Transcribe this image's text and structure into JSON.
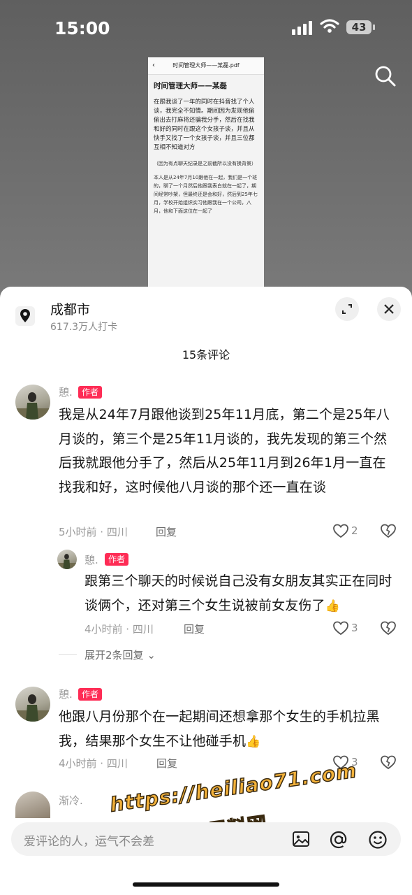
{
  "status": {
    "time": "15:00",
    "battery": "43"
  },
  "document": {
    "header": "时间管理大师——某磊.pdf",
    "title": "时间管理大师——某磊",
    "para1": "在跟我谈了一年的同时在抖音找了个人谈，我完全不知情。期间因为发现他偷偷出去打麻将还骗我分手，然后在找我和好的同时在跟这个女孩子谈，并且从快手又找了一个女孩子谈，并且三位都互相不知道对方",
    "para2": "（因为有点聊天纪录是之前截所以没有换背景）",
    "para3": "本人是从24年7月10跟他在一起，我们是一个班的，聊了一个月然后他跟我表白就在一起了，期间经常吵架，但最终还是会和好，然后到25年七月，学校开始组织实习他跟我在一个公司，八月，他和下面这位在一起了"
  },
  "location": {
    "city": "成都市",
    "checkins": "617.3万人打卡"
  },
  "comments_title": "15条评论",
  "comments": [
    {
      "user": "憩.",
      "badge": "作者",
      "text": "我是从24年7月跟他谈到25年11月底，第二个是25年八月谈的，第三个是25年11月谈的，我先发现的第三个然后我就跟他分手了，然后从25年11月到26年1月一直在找我和好，这时候他八月谈的那个还一直在谈",
      "meta": "5小时前 · 四川",
      "reply": "回复",
      "likes": "2",
      "sub": {
        "user": "憩.",
        "badge": "作者",
        "text": "跟第三个聊天的时候说自己没有女朋友其实正在同时谈俩个，还对第三个女生说被前女友伤了",
        "emoji": "👍",
        "meta": "4小时前 · 四川",
        "reply": "回复",
        "likes": "3"
      },
      "expand": "展开2条回复"
    },
    {
      "user": "憩.",
      "badge": "作者",
      "text": "他跟八月份那个在一起期间还想拿那个女生的手机拉黑我，结果那个女生不让他碰手机",
      "emoji": "👍",
      "meta": "4小时前 · 四川",
      "reply": "回复",
      "likes": "3"
    },
    {
      "user": "渐冷."
    }
  ],
  "input": {
    "placeholder": "爱评论的人，运气不会差"
  },
  "watermark": {
    "url": "https://heiliao71.com",
    "name": "黑料网"
  }
}
